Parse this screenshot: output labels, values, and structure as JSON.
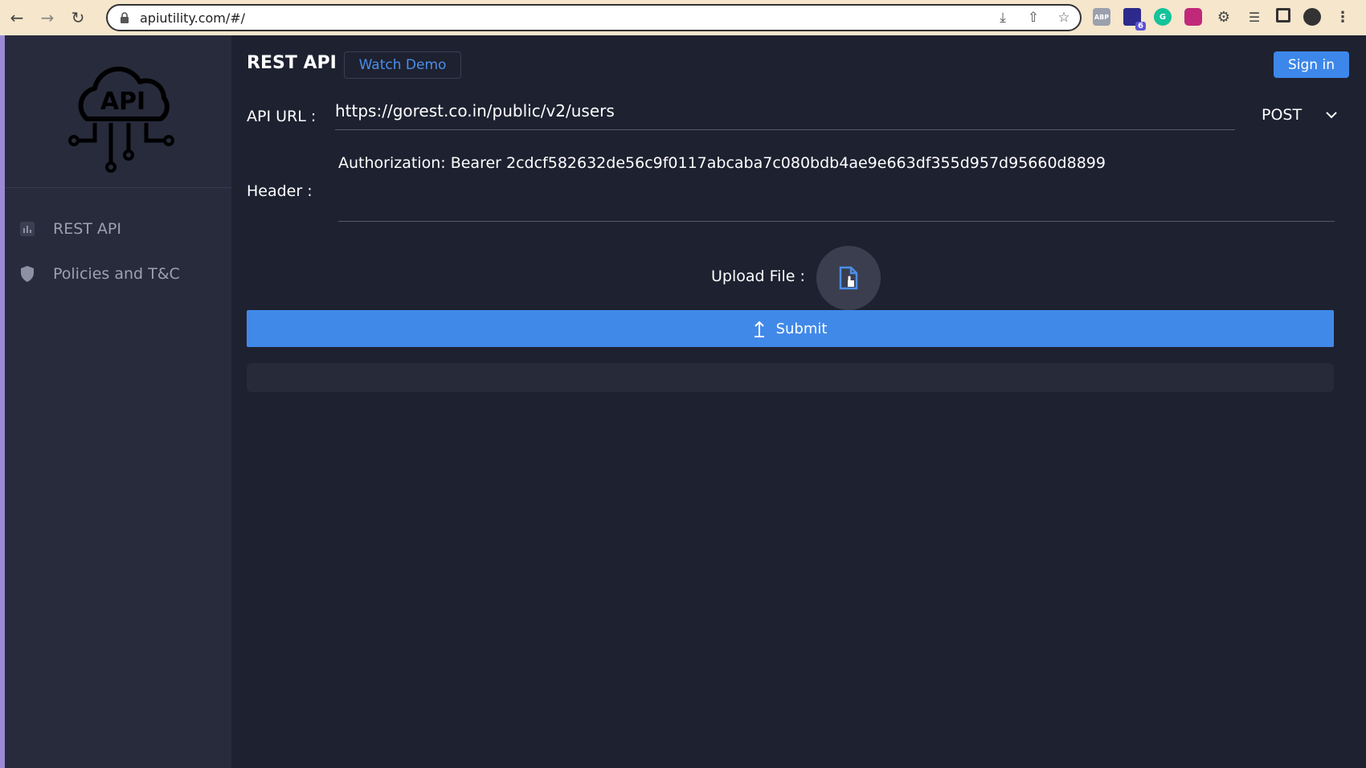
{
  "browser": {
    "url": "apiutility.com/#/",
    "extension_badge": "6",
    "abp_label": "ABP",
    "g_label": "G"
  },
  "sidebar": {
    "logo_text": "API",
    "items": [
      {
        "label": "REST API",
        "icon": "chart-icon"
      },
      {
        "label": "Policies and T&C",
        "icon": "shield-icon"
      }
    ]
  },
  "header": {
    "title": "REST API",
    "watch_demo_label": "Watch Demo",
    "sign_in_label": "Sign in"
  },
  "form": {
    "api_url_label": "API URL :",
    "api_url_value": "https://gorest.co.in/public/v2/users",
    "method_value": "POST",
    "header_label": "Header :",
    "header_value": "Authorization: Bearer 2cdcf582632de56c9f0117abcaba7c080bdb4ae9e663df355d957d95660d8899",
    "upload_label": "Upload File :",
    "submit_label": "Submit"
  },
  "colors": {
    "accent": "#4189e8",
    "background": "#1e2130",
    "sidebar": "#272b3b"
  }
}
